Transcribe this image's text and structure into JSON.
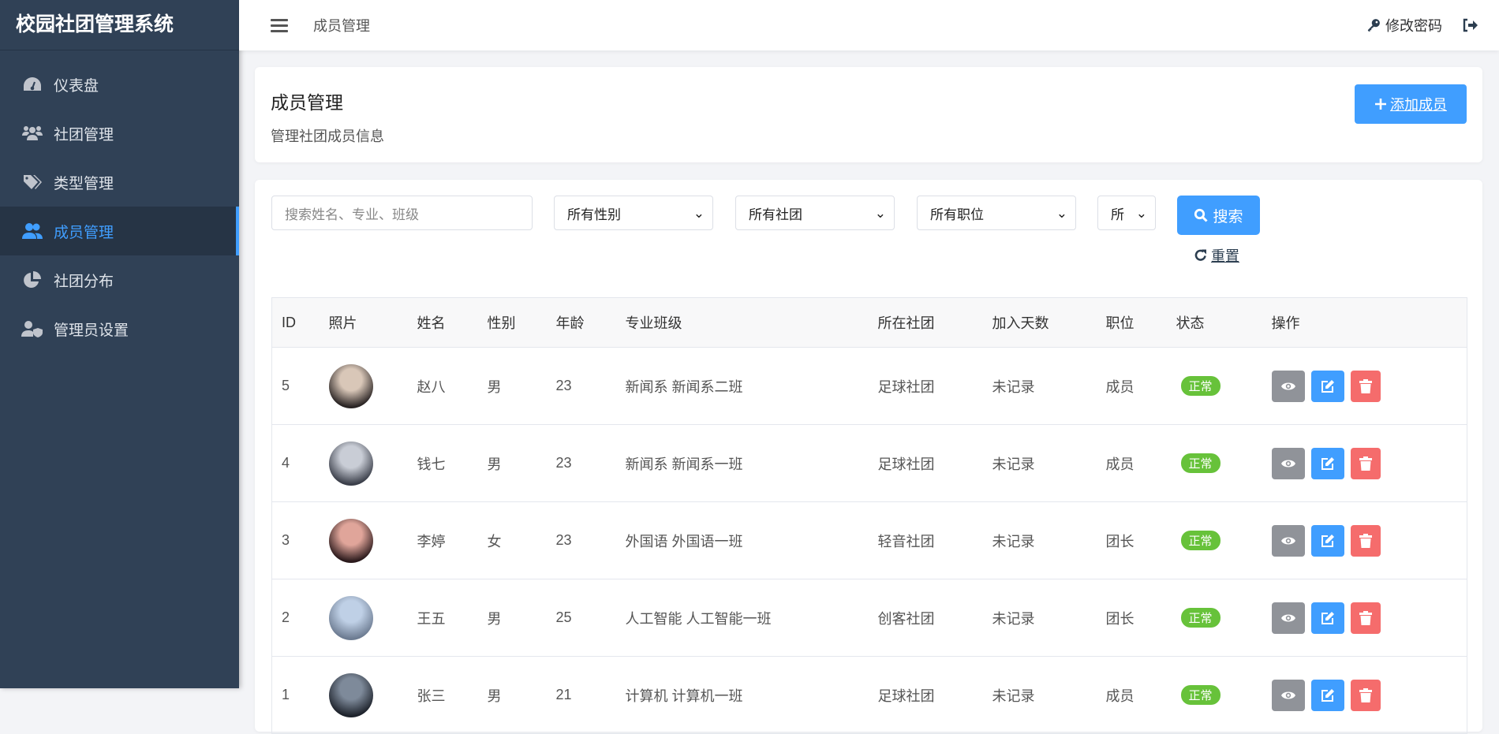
{
  "app_title": "校园社团管理系统",
  "sidebar": {
    "items": [
      {
        "label": "仪表盘",
        "icon": "dashboard-icon"
      },
      {
        "label": "社团管理",
        "icon": "users-icon"
      },
      {
        "label": "类型管理",
        "icon": "tags-icon"
      },
      {
        "label": "成员管理",
        "icon": "user-friends-icon",
        "active": true
      },
      {
        "label": "社团分布",
        "icon": "pie-chart-icon"
      },
      {
        "label": "管理员设置",
        "icon": "user-shield-icon"
      }
    ]
  },
  "header": {
    "breadcrumb": "成员管理",
    "change_password": "修改密码"
  },
  "page": {
    "title": "成员管理",
    "subtitle": "管理社团成员信息",
    "add_label": "添加成员"
  },
  "filters": {
    "search_placeholder": "搜索姓名、专业、班级",
    "gender": "所有性别",
    "club": "所有社团",
    "position": "所有职位",
    "status": "所有状态",
    "search_label": "搜索",
    "reset_label": "重置"
  },
  "table": {
    "columns": [
      "ID",
      "照片",
      "姓名",
      "性别",
      "年龄",
      "专业班级",
      "所在社团",
      "加入天数",
      "职位",
      "状态",
      "操作"
    ],
    "rows": [
      {
        "id": "5",
        "name": "赵八",
        "gender": "男",
        "age": "23",
        "major": "新闻系 新闻系二班",
        "club": "足球社团",
        "days": "未记录",
        "position": "成员",
        "status": "正常",
        "avatar": [
          "#d9c7b8",
          "#2a2424"
        ]
      },
      {
        "id": "4",
        "name": "钱七",
        "gender": "男",
        "age": "23",
        "major": "新闻系 新闻系一班",
        "club": "足球社团",
        "days": "未记录",
        "position": "成员",
        "status": "正常",
        "avatar": [
          "#c9cdd6",
          "#3b3f4a"
        ]
      },
      {
        "id": "3",
        "name": "李婷",
        "gender": "女",
        "age": "23",
        "major": "外国语 外国语一班",
        "club": "轻音社团",
        "days": "未记录",
        "position": "团长",
        "status": "正常",
        "avatar": [
          "#e0a59a",
          "#2b1a1c"
        ]
      },
      {
        "id": "2",
        "name": "王五",
        "gender": "男",
        "age": "25",
        "major": "人工智能 人工智能一班",
        "club": "创客社团",
        "days": "未记录",
        "position": "团长",
        "status": "正常",
        "avatar": [
          "#bfd0e6",
          "#6d7c92"
        ]
      },
      {
        "id": "1",
        "name": "张三",
        "gender": "男",
        "age": "21",
        "major": "计算机 计算机一班",
        "club": "足球社团",
        "days": "未记录",
        "position": "成员",
        "status": "正常",
        "avatar": [
          "#7e8a9a",
          "#1d222b"
        ]
      }
    ]
  },
  "colors": {
    "primary": "#409eff",
    "success": "#67c23a",
    "danger": "#f56c6c",
    "info": "#909399",
    "sidebar": "#304156"
  }
}
